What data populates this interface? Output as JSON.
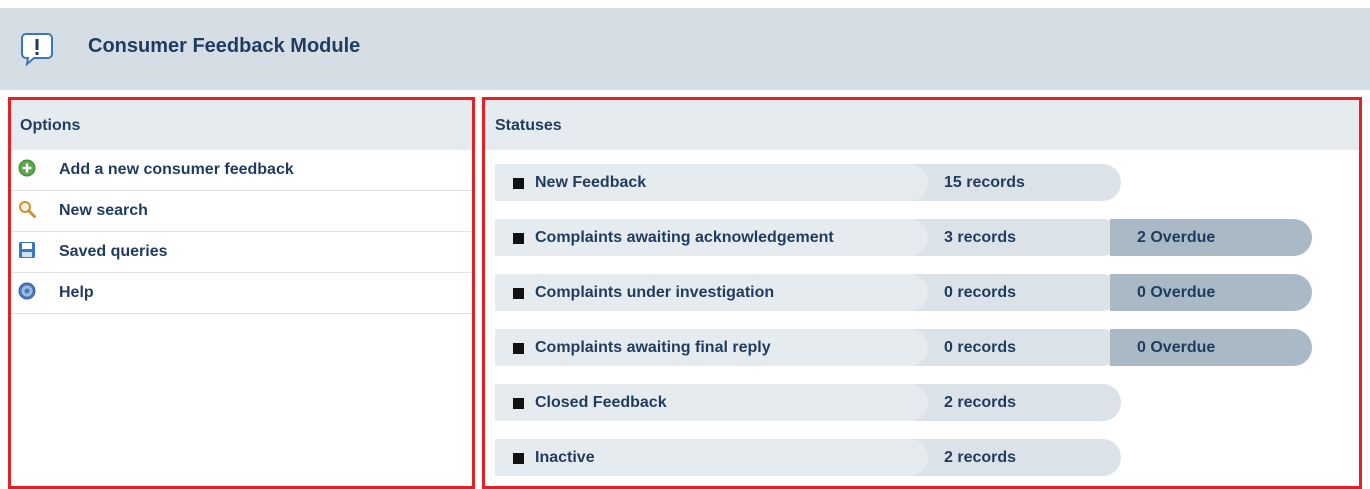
{
  "module": {
    "title": "Consumer Feedback Module",
    "icon": "speech-bubble-exclamation-icon"
  },
  "options": {
    "header": "Options",
    "items": [
      {
        "label": "Add a new consumer feedback",
        "icon": "add-icon",
        "color": "#5aa84a"
      },
      {
        "label": "New search",
        "icon": "search-icon",
        "color": "#c9922c"
      },
      {
        "label": "Saved queries",
        "icon": "save-icon",
        "color": "#3b78c3"
      },
      {
        "label": "Help",
        "icon": "help-icon",
        "color": "#4a77b8"
      }
    ]
  },
  "statuses": {
    "header": "Statuses",
    "rows": [
      {
        "name": "New Feedback",
        "count": "15 records",
        "overdue": null
      },
      {
        "name": "Complaints awaiting acknowledgement",
        "count": "3 records",
        "overdue": "2 Overdue"
      },
      {
        "name": "Complaints under investigation",
        "count": "0 records",
        "overdue": "0 Overdue"
      },
      {
        "name": "Complaints awaiting final reply",
        "count": "0 records",
        "overdue": "0 Overdue"
      },
      {
        "name": "Closed Feedback",
        "count": "2 records",
        "overdue": null
      },
      {
        "name": "Inactive",
        "count": "2 records",
        "overdue": null
      }
    ]
  },
  "colors": {
    "header_bg": "#d6dee5",
    "panel_header_bg": "#e6ebef",
    "highlight_border": "#e81e25",
    "text": "#1f3c5f",
    "overdue_bg": "#a9b9c6"
  }
}
